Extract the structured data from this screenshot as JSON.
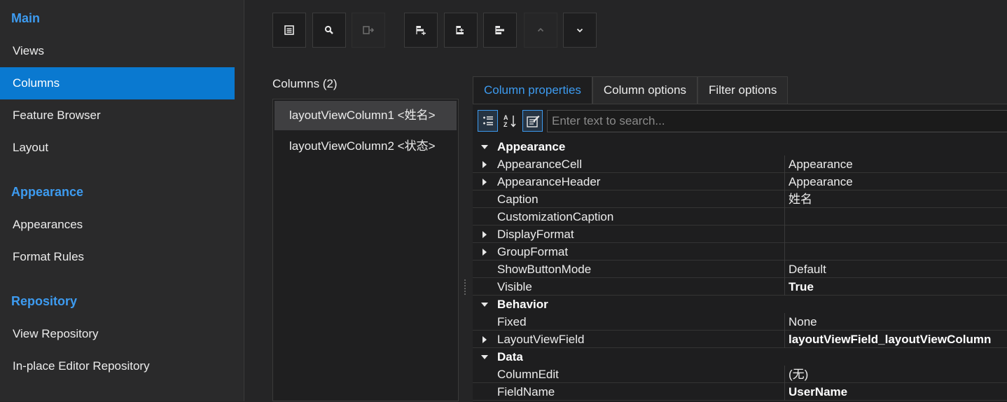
{
  "sidebar": {
    "groups": [
      {
        "title": "Main",
        "items": [
          "Views",
          "Columns",
          "Feature Browser",
          "Layout"
        ]
      },
      {
        "title": "Appearance",
        "items": [
          "Appearances",
          "Format Rules"
        ]
      },
      {
        "title": "Repository",
        "items": [
          "View Repository",
          "In-place Editor Repository"
        ]
      }
    ],
    "active_item": "Columns"
  },
  "toolbar": {
    "buttons": [
      {
        "icon": "show-list-icon",
        "enabled": true
      },
      {
        "icon": "search-icon",
        "enabled": true
      },
      {
        "icon": "remove-column-icon",
        "enabled": false
      },
      {
        "icon": "add-column-icon",
        "enabled": true
      },
      {
        "icon": "insert-column-icon",
        "enabled": true
      },
      {
        "icon": "delete-column-icon",
        "enabled": true
      },
      {
        "icon": "chevron-up-icon",
        "enabled": false
      },
      {
        "icon": "chevron-down-icon",
        "enabled": true
      }
    ]
  },
  "columns": {
    "label": "Columns (2)",
    "items": [
      "layoutViewColumn1 <姓名>",
      "layoutViewColumn2 <状态>"
    ],
    "selected_index": 0
  },
  "tabs": [
    "Column properties",
    "Column options",
    "Filter options"
  ],
  "active_tab": "Column properties",
  "search": {
    "placeholder": "Enter text to search..."
  },
  "property_grid": {
    "rows": [
      {
        "type": "category",
        "name": "Appearance",
        "expanded": true
      },
      {
        "type": "prop",
        "name": "AppearanceCell",
        "value": "Appearance",
        "expandable": true,
        "bold": false
      },
      {
        "type": "prop",
        "name": "AppearanceHeader",
        "value": "Appearance",
        "expandable": true,
        "bold": false
      },
      {
        "type": "prop",
        "name": "Caption",
        "value": "姓名",
        "expandable": false,
        "bold": false
      },
      {
        "type": "prop",
        "name": "CustomizationCaption",
        "value": "",
        "expandable": false,
        "bold": false
      },
      {
        "type": "prop",
        "name": "DisplayFormat",
        "value": "",
        "expandable": true,
        "bold": false
      },
      {
        "type": "prop",
        "name": "GroupFormat",
        "value": "",
        "expandable": true,
        "bold": false
      },
      {
        "type": "prop",
        "name": "ShowButtonMode",
        "value": "Default",
        "expandable": false,
        "bold": false
      },
      {
        "type": "prop",
        "name": "Visible",
        "value": "True",
        "expandable": false,
        "bold": true
      },
      {
        "type": "category",
        "name": "Behavior",
        "expanded": true
      },
      {
        "type": "prop",
        "name": "Fixed",
        "value": "None",
        "expandable": false,
        "bold": false
      },
      {
        "type": "prop",
        "name": "LayoutViewField",
        "value": "layoutViewField_layoutViewColumn",
        "expandable": true,
        "bold": true
      },
      {
        "type": "category",
        "name": "Data",
        "expanded": true
      },
      {
        "type": "prop",
        "name": "ColumnEdit",
        "value": "(无)",
        "expandable": false,
        "bold": false
      },
      {
        "type": "prop",
        "name": "FieldName",
        "value": "UserName",
        "expandable": false,
        "bold": true
      }
    ]
  },
  "colors": {
    "accent": "#3d9bf0",
    "selection": "#0a79d0",
    "background": "#252526"
  }
}
